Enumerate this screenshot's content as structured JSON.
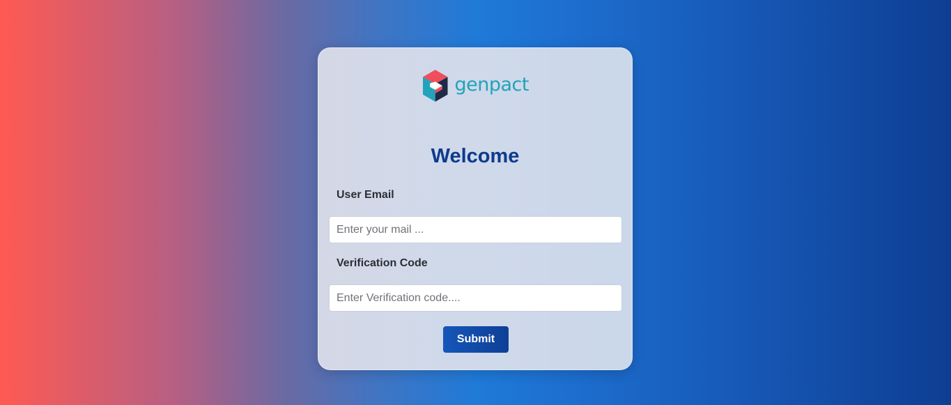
{
  "brand": {
    "logo_text": "genpact",
    "logo_colors": [
      "#ef4e5c",
      "#22a3b9",
      "#1e2a4a"
    ]
  },
  "login": {
    "title": "Welcome",
    "email_label": "User Email",
    "email_placeholder": "Enter your mail ...",
    "email_value": "",
    "code_label": "Verification Code",
    "code_placeholder": "Enter Verification code....",
    "code_value": "",
    "submit_label": "Submit"
  },
  "colors": {
    "accent": "#0f3a8c",
    "button": "#1556b8",
    "gradient_left": "#ff5a52",
    "gradient_mid": "#1f7ad8",
    "gradient_right": "#0d3e93"
  }
}
